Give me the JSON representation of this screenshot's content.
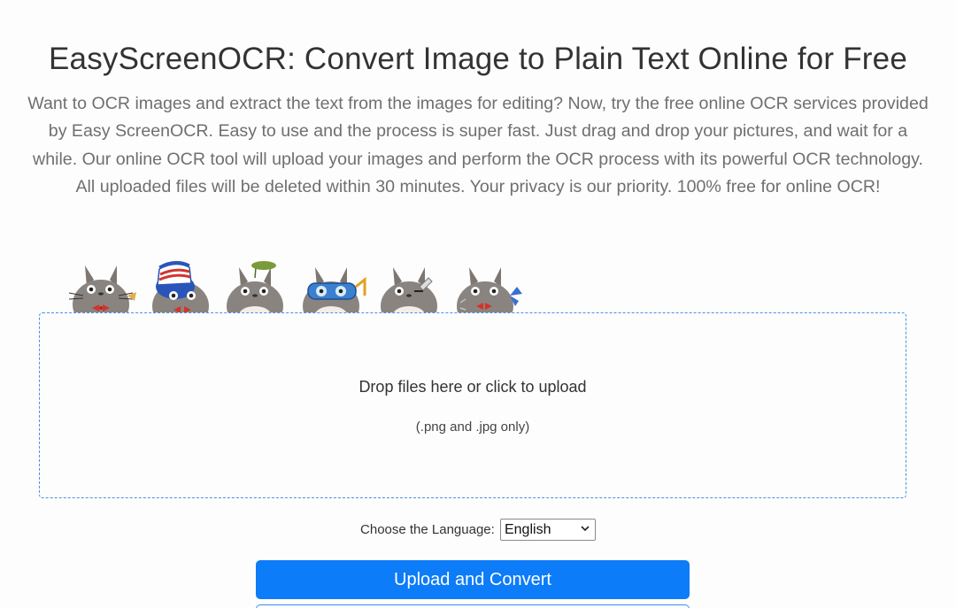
{
  "header": {
    "title": "EasyScreenOCR: Convert Image to Plain Text Online for Free",
    "description": "Want to OCR images and extract the text from the images for editing? Now, try the free online OCR services provided by Easy ScreenOCR. Easy to use and the process is super fast. Just drag and drop your pictures, and wait for a while. Our online OCR tool will upload your images and perform the OCR process with its powerful OCR technology. All uploaded files will be deleted within 30 minutes. Your privacy is our priority. 100% free for online OCR!"
  },
  "mascots": [
    {
      "name": "totoro-mascot-icon"
    },
    {
      "name": "totoro-uncle-sam-hat-mascot-icon"
    },
    {
      "name": "totoro-leaf-mascot-icon"
    },
    {
      "name": "totoro-goggles-mascot-icon"
    },
    {
      "name": "totoro-pencil-mascot-icon"
    },
    {
      "name": "totoro-butterfly-mascot-icon"
    }
  ],
  "dropzone": {
    "main_text": "Drop files here or click to upload",
    "sub_text": "(.png and .jpg only)"
  },
  "language": {
    "label": "Choose the Language:",
    "selected": "English"
  },
  "actions": {
    "upload_label": "Upload and Convert"
  },
  "colors": {
    "primary": "#0d7cf8",
    "dropzone_border": "#4a90e2",
    "title_text": "#333333",
    "description_text": "#6f6f6f"
  }
}
